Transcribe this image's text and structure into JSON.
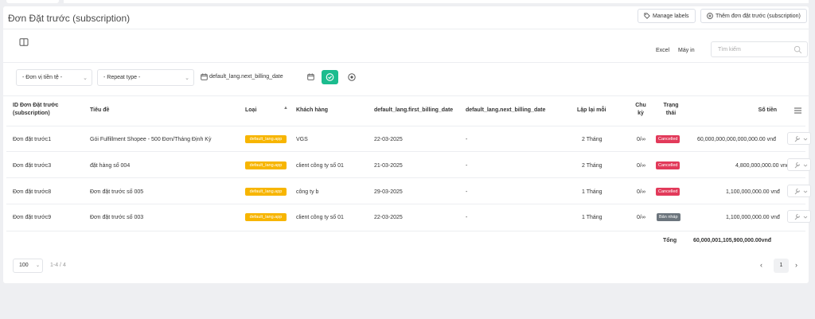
{
  "title": "Đơn Đặt trước (subscription)",
  "header_buttons": {
    "manage_labels": "Manage labels",
    "add": "Thêm đơn đặt trước (subscription)"
  },
  "toolbar": {
    "excel": "Excel",
    "print": "Máy in",
    "search_placeholder": "Tìm kiếm"
  },
  "filters": {
    "currency": "- Đơn vị tiền tệ -",
    "repeat_type": "- Repeat type -",
    "date_field": "default_lang.next_billing_date"
  },
  "columns": {
    "id": "ID Đơn Đặt trước (subscription)",
    "title": "Tiêu đề",
    "type": "Loại",
    "customer": "Khách hàng",
    "first_billing": "default_lang.first_billing_date",
    "next_billing": "default_lang.next_billing_date",
    "repeat": "Lặp lại mỗi",
    "cycles": "Chu kỳ",
    "status": "Trạng thái",
    "amount": "Số tiền"
  },
  "rows": [
    {
      "id": "Đơn đặt trước1",
      "title": "Gói Fulfillment Shopee - 500 Đơn/Tháng Định Kỳ",
      "type": "default_lang.app",
      "customer": "VGS",
      "first_billing": "22-03-2025",
      "next_billing": "-",
      "repeat": "2 Tháng",
      "cycles": "0/∞",
      "status": "Cancelled",
      "amount": "60,000,000,000,000,000.00 vnđ"
    },
    {
      "id": "Đơn đặt trước3",
      "title": "đặt hàng số 004",
      "type": "default_lang.app",
      "customer": "client công ty số 01",
      "first_billing": "21-03-2025",
      "next_billing": "-",
      "repeat": "2 Tháng",
      "cycles": "0/∞",
      "status": "Cancelled",
      "amount": "4,800,000,000.00 vnđ"
    },
    {
      "id": "Đơn đặt trước8",
      "title": "Đơn đặt trước số 005",
      "type": "default_lang.app",
      "customer": "công ty b",
      "first_billing": "29-03-2025",
      "next_billing": "-",
      "repeat": "1 Tháng",
      "cycles": "0/∞",
      "status": "Cancelled",
      "amount": "1,100,000,000.00 vnđ"
    },
    {
      "id": "Đơn đặt trước9",
      "title": "Đơn đặt trước số 003",
      "type": "default_lang.app",
      "customer": "client công ty số 01",
      "first_billing": "22-03-2025",
      "next_billing": "-",
      "repeat": "1 Tháng",
      "cycles": "0/∞",
      "status": "Bản nháp",
      "amount": "1,100,000,000.00 vnđ"
    }
  ],
  "totals": {
    "label": "Tổng",
    "value": "60,000,001,105,900,000.00vnđ"
  },
  "pagination": {
    "page_size": "100",
    "info": "1-4 / 4",
    "current": "1"
  },
  "colors": {
    "accent": "#1bbc8e",
    "cancelled": "#e23a5a",
    "draft": "#6c757d",
    "type_badge": "#f7b500"
  }
}
